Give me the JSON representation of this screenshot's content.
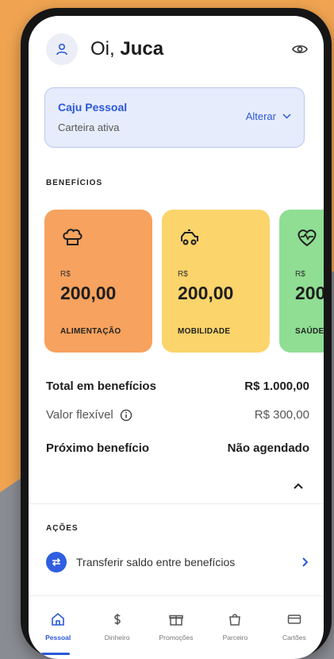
{
  "header": {
    "greeting_prefix": "Oi,",
    "user_name": "Juca"
  },
  "wallet": {
    "name": "Caju Pessoal",
    "status": "Carteira ativa",
    "change_label": "Alterar"
  },
  "benefits": {
    "section_title": "BENEFÍCIOS",
    "cards": [
      {
        "currency": "R$",
        "amount": "200,00",
        "label": "ALIMENTAÇÃO",
        "icon": "chef-hat-icon",
        "color": "#f7a25e"
      },
      {
        "currency": "R$",
        "amount": "200,00",
        "label": "MOBILIDADE",
        "icon": "car-icon",
        "color": "#fbd46b"
      },
      {
        "currency": "R$",
        "amount": "200",
        "label": "SAÚDE",
        "icon": "heart-pulse-icon",
        "color": "#8fde93"
      }
    ]
  },
  "summary": {
    "total_label": "Total em benefícios",
    "total_value": "R$ 1.000,00",
    "flex_label": "Valor flexível",
    "flex_value": "R$ 300,00",
    "next_label": "Próximo benefício",
    "next_value": "Não agendado"
  },
  "actions": {
    "section_title": "AÇÕES",
    "transfer_label": "Transferir saldo entre benefícios"
  },
  "nav": {
    "items": [
      {
        "label": "Pessoal",
        "icon": "home-icon",
        "active": true
      },
      {
        "label": "Dinheiro",
        "icon": "dollar-icon",
        "active": false
      },
      {
        "label": "Promoções",
        "icon": "gift-icon",
        "active": false
      },
      {
        "label": "Parceiro",
        "icon": "bag-icon",
        "active": false
      },
      {
        "label": "Cartões",
        "icon": "card-icon",
        "active": false
      }
    ]
  },
  "colors": {
    "accent": "#2c58d8",
    "background_orange": "#f0a451"
  }
}
